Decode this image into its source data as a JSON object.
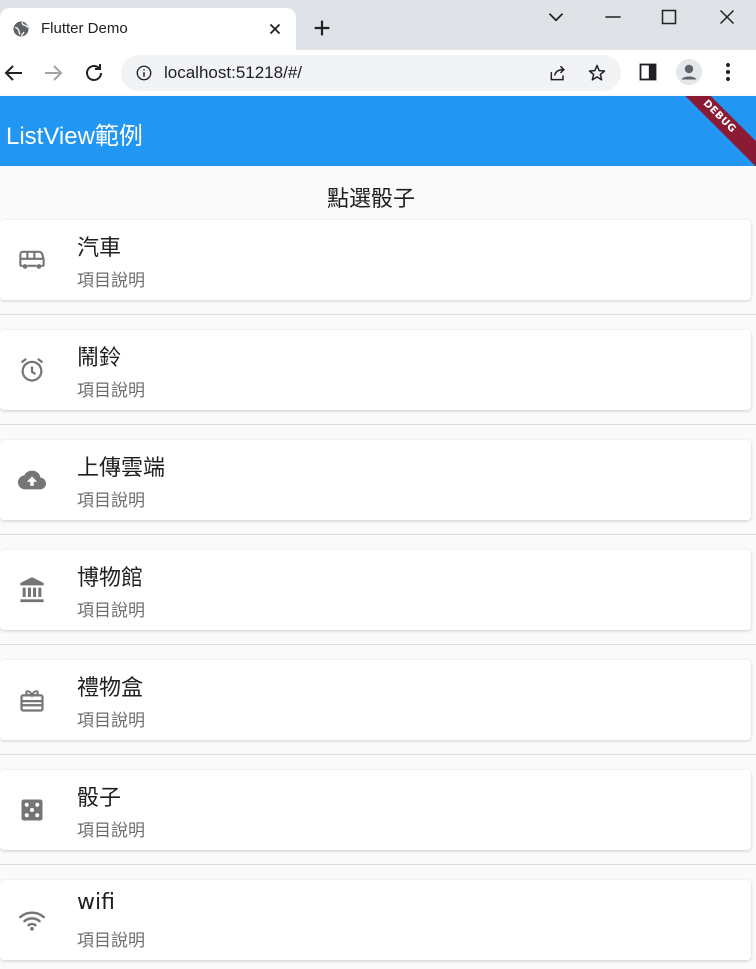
{
  "browser": {
    "tab_title": "Flutter Demo",
    "url": "localhost:51218/#/"
  },
  "app": {
    "title": "ListView範例",
    "debug_banner": "DEBUG",
    "header": "點選骰子",
    "accent_color": "#2196f3"
  },
  "items": [
    {
      "icon": "bus-icon",
      "title": "汽車",
      "subtitle": "項目說明"
    },
    {
      "icon": "alarm-icon",
      "title": "鬧鈴",
      "subtitle": "項目說明"
    },
    {
      "icon": "cloud-upload-icon",
      "title": "上傳雲端",
      "subtitle": "項目說明"
    },
    {
      "icon": "museum-icon",
      "title": "博物館",
      "subtitle": "項目說明"
    },
    {
      "icon": "gift-icon",
      "title": "禮物盒",
      "subtitle": "項目說明"
    },
    {
      "icon": "dice-icon",
      "title": "骰子",
      "subtitle": "項目說明"
    },
    {
      "icon": "wifi-icon",
      "title": "wifi",
      "subtitle": "項目說明"
    }
  ]
}
